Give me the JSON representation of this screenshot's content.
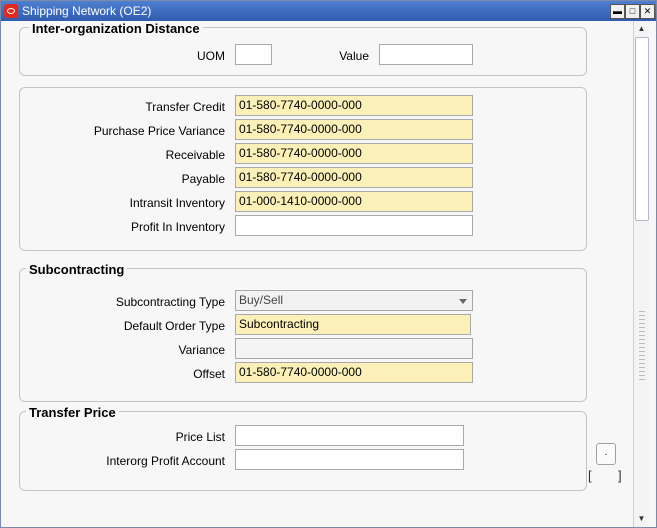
{
  "window": {
    "title": "Shipping Network (OE2)",
    "buttons": {
      "minimize": "▬",
      "maximize": "□",
      "close": "✕"
    }
  },
  "inter_org_distance": {
    "title": "Inter-organization Distance",
    "uom_label": "UOM",
    "uom_value": "",
    "value_label": "Value",
    "value_value": ""
  },
  "accounts": {
    "fields": [
      {
        "label": "Transfer Credit",
        "value": "01-580-7740-0000-000"
      },
      {
        "label": "Purchase Price Variance",
        "value": "01-580-7740-0000-000"
      },
      {
        "label": "Receivable",
        "value": "01-580-7740-0000-000"
      },
      {
        "label": "Payable",
        "value": "01-580-7740-0000-000"
      },
      {
        "label": "Intransit Inventory",
        "value": "01-000-1410-0000-000"
      },
      {
        "label": "Profit In Inventory",
        "value": ""
      }
    ]
  },
  "subcontracting": {
    "title": "Subcontracting",
    "type_label": "Subcontracting Type",
    "type_value": "Buy/Sell",
    "order_type_label": "Default Order Type",
    "order_type_value": "Subcontracting",
    "variance_label": "Variance",
    "variance_value": "",
    "offset_label": "Offset",
    "offset_value": "01-580-7740-0000-000"
  },
  "transfer_price": {
    "title": "Transfer Price",
    "price_list_label": "Price List",
    "price_list_value": "",
    "profit_account_label": "Interorg Profit Account",
    "profit_account_value": ""
  },
  "misc": {
    "bracket_open": "[",
    "bracket_close": "]",
    "small_box": "."
  },
  "scrollbar": {
    "up": "▲",
    "down": "▼"
  }
}
